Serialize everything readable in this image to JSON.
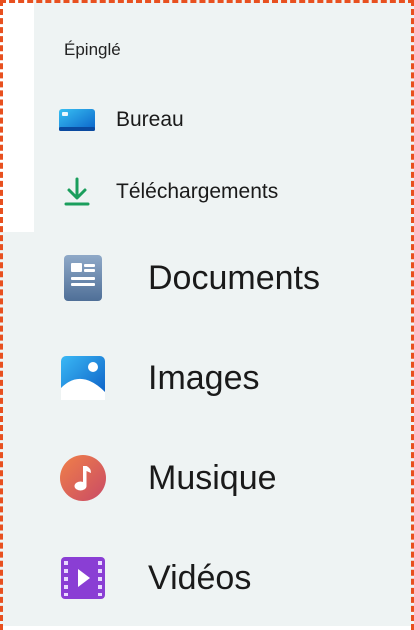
{
  "sidebar": {
    "section_label": "Épinglé",
    "items": [
      {
        "label": "Bureau",
        "icon": "desktop-icon"
      },
      {
        "label": "Téléchargements",
        "icon": "download-icon"
      },
      {
        "label": "Documents",
        "icon": "documents-icon"
      },
      {
        "label": "Images",
        "icon": "images-icon"
      },
      {
        "label": "Musique",
        "icon": "music-icon"
      },
      {
        "label": "Vidéos",
        "icon": "videos-icon"
      }
    ]
  },
  "colors": {
    "frame_border": "#e8501f",
    "panel_background": "#eef3f3",
    "download_accent": "#1a9e5c",
    "images_accent": "#1a7fd1",
    "music_accent": "#e0604a",
    "videos_accent": "#8a3ed4"
  }
}
